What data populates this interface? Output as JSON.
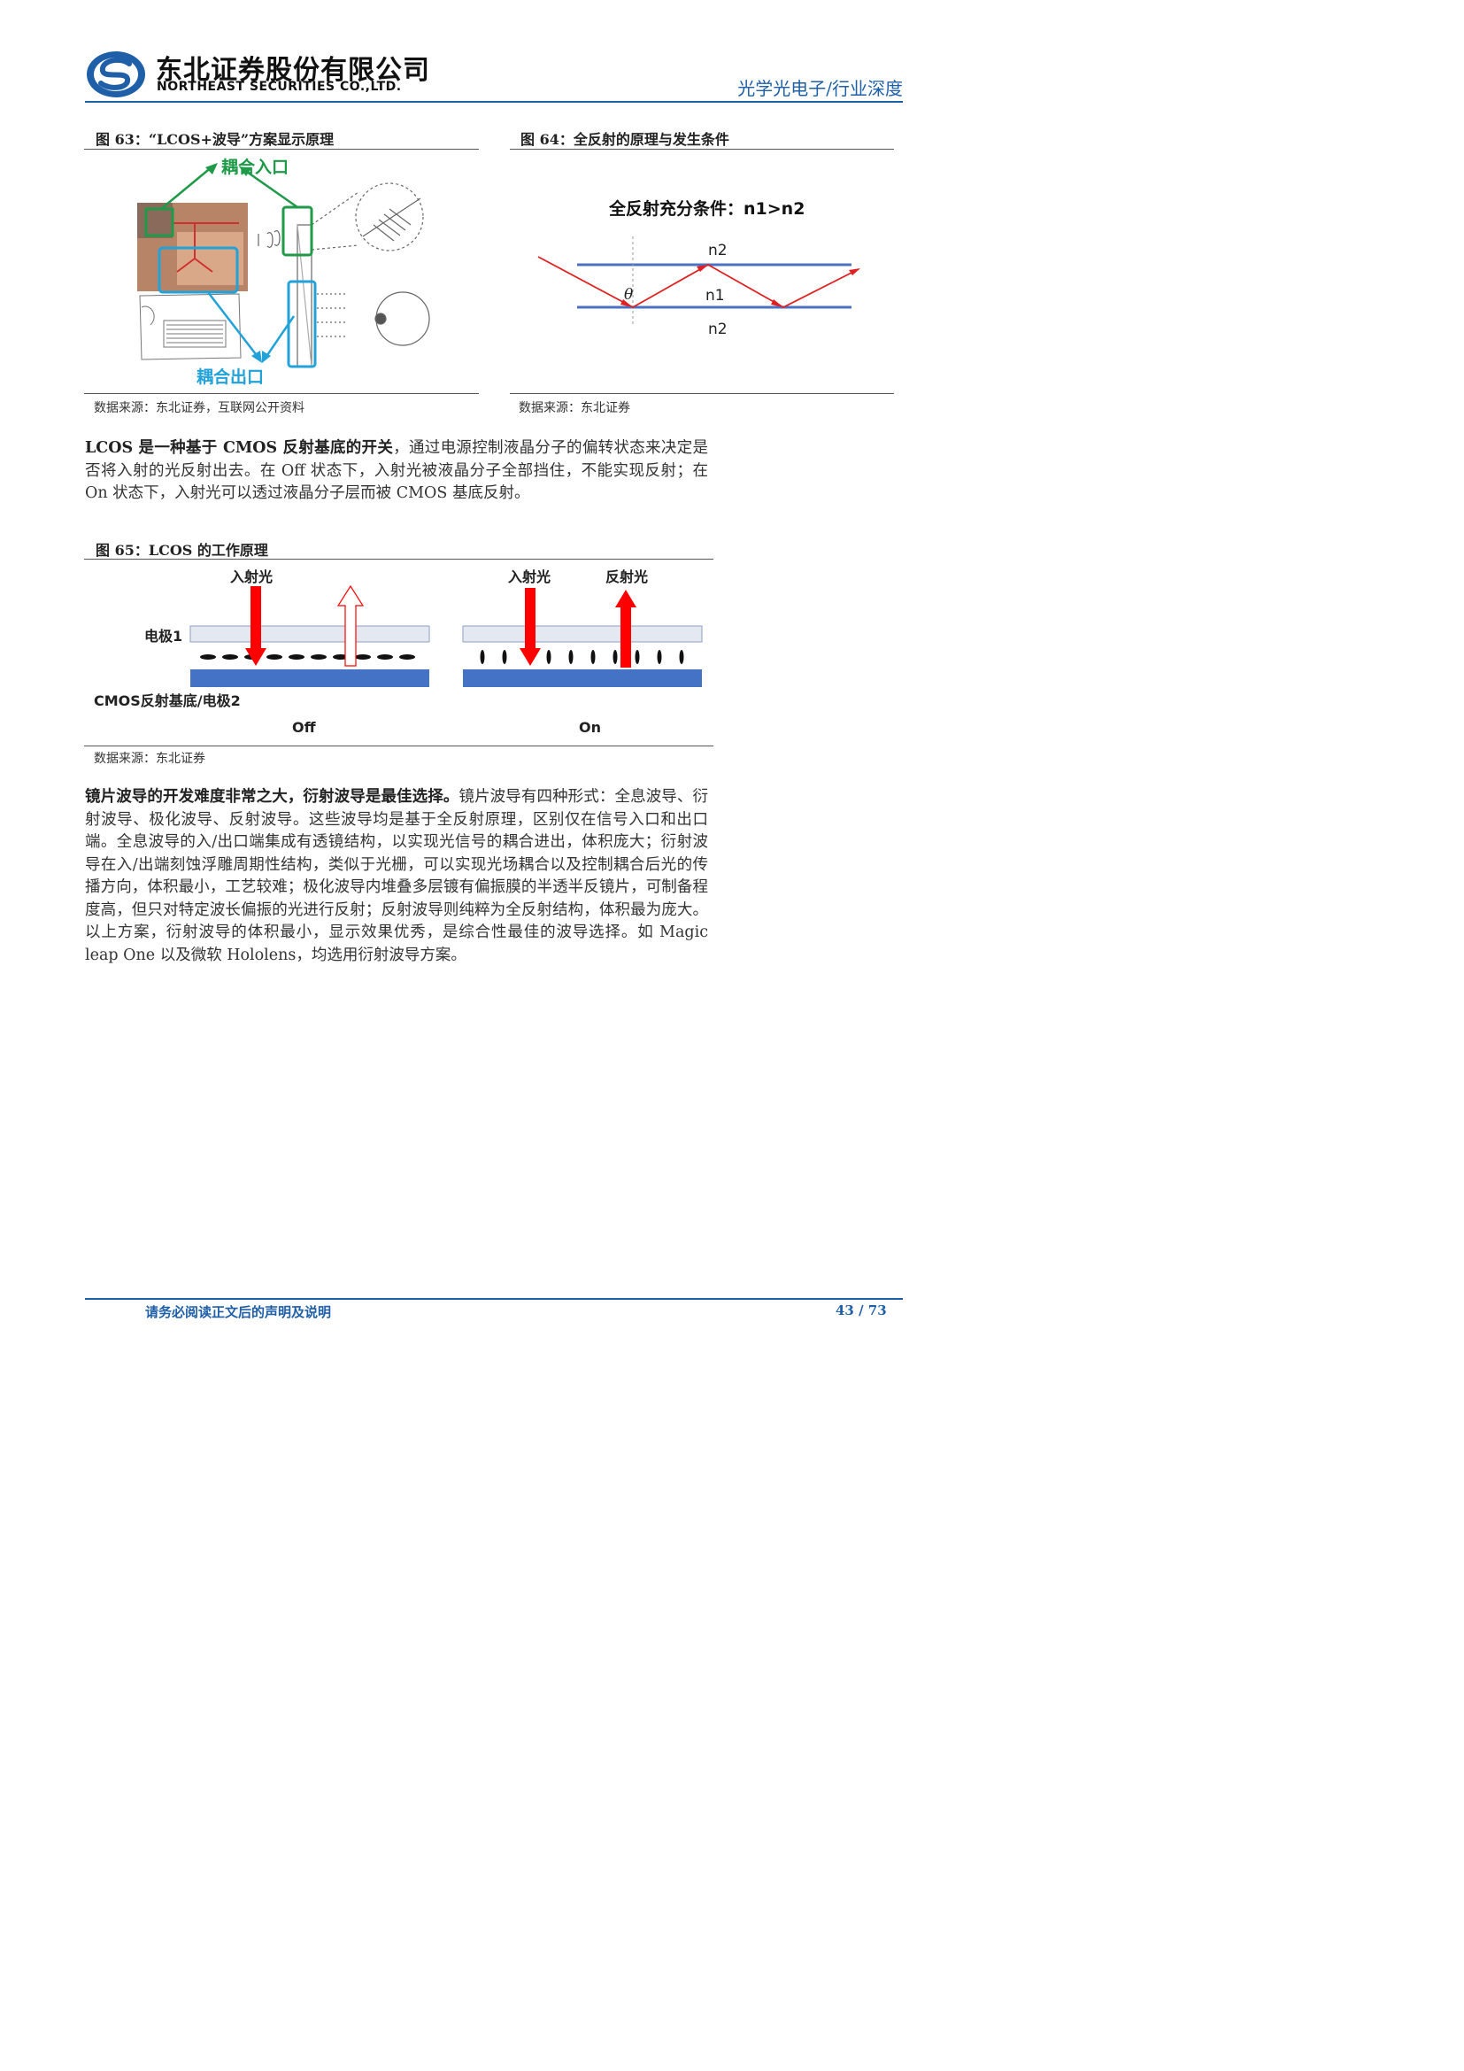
{
  "header": {
    "company_cn": "东北证券股份有限公司",
    "company_en": "NORTHEAST SECURITIES CO.,LTD.",
    "category": "光学光电子/行业深度",
    "brand_color": "#1f5fa8"
  },
  "fig63": {
    "title": "图 63：“LCOS+波导”方案显示原理",
    "label_in": "耦合入口",
    "label_out": "耦合出口",
    "source": "数据来源：东北证券，互联网公开资料"
  },
  "fig64": {
    "title": "图 64：全反射的原理与发生条件",
    "diagram_title": "全反射充分条件：n1>n2",
    "n_top": "n2",
    "n_mid": "n1",
    "n_bottom": "n2",
    "angle": "θ",
    "source": "数据来源：东北证券"
  },
  "para1": {
    "bold": "LCOS 是一种基于 CMOS 反射基底的开关",
    "text": "，通过电源控制液晶分子的偏转状态来决定是否将入射的光反射出去。在 Off 状态下，入射光被液晶分子全部挡住，不能实现反射；在 On 状态下，入射光可以透过液晶分子层而被 CMOS 基底反射。"
  },
  "fig65": {
    "title": "图 65：LCOS 的工作原理",
    "incident_left": "入射光",
    "incident_right": "入射光",
    "reflected": "反射光",
    "electrode1": "电极1",
    "electrode2": "CMOS反射基底/电极2",
    "off": "Off",
    "on": "On",
    "source": "数据来源：东北证券"
  },
  "para2": {
    "bold": "镜片波导的开发难度非常之大，衍射波导是最佳选择。",
    "text": "镜片波导有四种形式：全息波导、衍射波导、极化波导、反射波导。这些波导均是基于全反射原理，区别仅在信号入口和出口端。全息波导的入/出口端集成有透镜结构，以实现光信号的耦合进出，体积庞大；衍射波导在入/出端刻蚀浮雕周期性结构，类似于光栅，可以实现光场耦合以及控制耦合后光的传播方向，体积最小，工艺较难；极化波导内堆叠多层镀有偏振膜的半透半反镜片，可制备程度高，但只对特定波长偏振的光进行反射；反射波导则纯粹为全反射结构，体积最为庞大。以上方案，衍射波导的体积最小，显示效果优秀，是综合性最佳的波导选择。如 Magic leap One 以及微软 Hololens，均选用衍射波导方案。"
  },
  "footer": {
    "notice": "请务必阅读正文后的声明及说明",
    "page": "43 / 73"
  }
}
